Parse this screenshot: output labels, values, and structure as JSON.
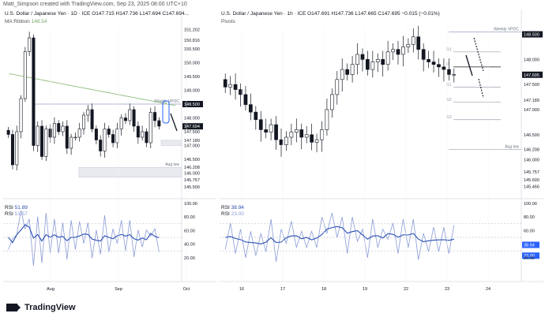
{
  "credit": "Matt_Simpson created with TradingView.com, Sep 23, 2025 08:00 UTC+10",
  "footer": {
    "logo_text": "TradingView",
    "logo_icon": "tradingview-logo-icon"
  },
  "left": {
    "title": "U.S. Dollar / Japanese Yen · 1D · ICE  O147.715  H147.736  L147.694  C147.694...",
    "ma_label": "MA Ribbon",
    "ma_value": "148.54",
    "rsi_line1_label": "RSI",
    "rsi_line1_value": "51.89",
    "rsi_line2_label": "RSI",
    "rsi_line2_value": "51.57",
    "x_labels": [
      "Aug",
      "Sep",
      "Oct"
    ],
    "price_labels": [
      "151.202",
      "150.816",
      "150.500",
      "150.000",
      "149.500",
      "149.000",
      "148.500",
      "148.000",
      "147.694",
      "147.500",
      "147.189",
      "147.000",
      "146.500",
      "146.208",
      "146.000",
      "145.757",
      "145.500"
    ],
    "rsi_labels": [
      "100.00",
      "80.00",
      "60.00",
      "40.00",
      "20.00"
    ],
    "annotations": [
      "Weekly VPOC",
      "Aug low"
    ]
  },
  "right": {
    "title": "U.S. Dollar / Japanese Yen · 1h · ICE  O147.691  H147.736  L147.665  C147.695  −0.015 (−0.01%)",
    "pivots_label": "Pivots",
    "rsi_line1_label": "RSI",
    "rsi_line1_value": "38.94",
    "rsi_line2_label": "RSI",
    "rsi_line2_value": "23.00",
    "x_labels": [
      "16",
      "17",
      "18",
      "19",
      "22",
      "23",
      "24"
    ],
    "price_labels": [
      "148.500",
      "148.000",
      "147.695",
      "147.500",
      "147.189",
      "147.000",
      "146.500",
      "146.208",
      "146.000",
      "145.757",
      "145.600",
      "145.466"
    ],
    "rsi_labels": [
      "100.00",
      "80.00",
      "60.00",
      "40.00",
      "38.94",
      "23.00",
      "20.00"
    ],
    "pivot_labels": [
      "R1",
      "P",
      "S1",
      "S2",
      "S3"
    ],
    "annotations": [
      "Weekly VPOC",
      "Aug low"
    ]
  },
  "colors": {
    "up": "#131722",
    "down": "#131722",
    "rsi_main": "#2a4fb3",
    "rsi_signal": "#8a9bd6",
    "ma": "#8fbf7f",
    "vpoc": "#9aa3c2",
    "price_tag": "#131722",
    "blue_tag": "#2962ff"
  },
  "chart_data": [
    {
      "type": "candlestick",
      "title": "U.S. Dollar / Japanese Yen · 1D · ICE",
      "timeframe": "1D",
      "x_ticks": [
        "Aug",
        "Sep",
        "Oct"
      ],
      "ylim": [
        145.3,
        151.3
      ],
      "close_approx": [
        147.4,
        146.3,
        147.5,
        148.7,
        150.4,
        150.9,
        147.0,
        147.7,
        146.6,
        147.6,
        147.3,
        147.8,
        147.5,
        147.7,
        146.9,
        147.3,
        147.3,
        147.6,
        148.1,
        148.3,
        147.6,
        147.2,
        146.8,
        147.6,
        147.4,
        147.1,
        147.6,
        148.0,
        147.9,
        148.3,
        147.7,
        147.3,
        147.5,
        147.1,
        148.2,
        147.9,
        147.7
      ],
      "ma_ribbon_last": 148.54,
      "levels": {
        "weekly_vpoc": 148.5,
        "aug_low": 146.208,
        "last": 147.694,
        "level_147_189": 147.189,
        "level_145_757": 145.757
      },
      "rsi": {
        "ylim": [
          0,
          100
        ],
        "levels": [
          30,
          50,
          70
        ],
        "last_rsi": 51.89,
        "last_signal": 51.57
      }
    },
    {
      "type": "candlestick",
      "title": "U.S. Dollar / Japanese Yen · 1h · ICE",
      "timeframe": "1h",
      "x_ticks": [
        "16",
        "17",
        "18",
        "19",
        "22",
        "23",
        "24"
      ],
      "ylim": [
        145.35,
        148.65
      ],
      "close_approx": [
        147.45,
        147.5,
        147.4,
        147.3,
        147.1,
        146.95,
        146.8,
        146.6,
        146.55,
        146.7,
        146.4,
        146.3,
        146.45,
        146.55,
        146.6,
        146.45,
        146.5,
        146.35,
        146.4,
        146.6,
        147.0,
        147.3,
        147.6,
        147.8,
        147.7,
        147.9,
        148.1,
        148.0,
        147.8,
        147.95,
        148.0,
        147.9,
        148.15,
        148.2,
        148.1,
        148.25,
        148.3,
        148.45,
        148.2,
        148.0,
        147.95,
        147.9,
        147.85,
        147.8,
        147.7,
        147.7
      ],
      "pivots": {
        "R1": 148.15,
        "P": 147.85,
        "S1": 147.45,
        "S2": 147.15,
        "S3": 146.8
      },
      "levels": {
        "weekly_vpoc": 148.55,
        "aug_low": 146.208,
        "last": 147.695
      },
      "rsi": {
        "ylim": [
          0,
          100
        ],
        "levels": [
          30,
          50,
          70
        ],
        "last_rsi": 38.94,
        "last_signal": 23.0
      }
    }
  ]
}
